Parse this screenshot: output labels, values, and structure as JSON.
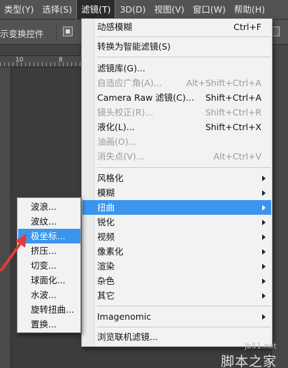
{
  "menubar": {
    "items": [
      "类型(Y)",
      "选择(S)",
      "滤镜(T)",
      "3D(D)",
      "视图(V)",
      "窗口(W)",
      "帮助(H)"
    ]
  },
  "optbar": {
    "transform_label": "示变换控件"
  },
  "ruler": {
    "labels": [
      "10",
      "8"
    ]
  },
  "filter_menu": {
    "items": [
      {
        "label": "动感模糊",
        "shortcut": "Ctrl+F",
        "enabled": true,
        "submenu": false
      },
      {
        "label": "转换为智能滤镜(S)",
        "shortcut": "",
        "enabled": true,
        "submenu": false
      },
      {
        "label": "滤镜库(G)...",
        "shortcut": "",
        "enabled": true,
        "submenu": false
      },
      {
        "label": "自适应广角(A)...",
        "shortcut": "Alt+Shift+Ctrl+A",
        "enabled": false,
        "submenu": false
      },
      {
        "label": "Camera Raw 滤镜(C)...",
        "shortcut": "Shift+Ctrl+A",
        "enabled": true,
        "submenu": false
      },
      {
        "label": "镜头校正(R)...",
        "shortcut": "Shift+Ctrl+R",
        "enabled": false,
        "submenu": false
      },
      {
        "label": "液化(L)...",
        "shortcut": "Shift+Ctrl+X",
        "enabled": true,
        "submenu": false
      },
      {
        "label": "油画(O)...",
        "shortcut": "",
        "enabled": false,
        "submenu": false
      },
      {
        "label": "消失点(V)...",
        "shortcut": "Alt+Ctrl+V",
        "enabled": false,
        "submenu": false
      },
      {
        "label": "风格化",
        "shortcut": "",
        "enabled": true,
        "submenu": true
      },
      {
        "label": "模糊",
        "shortcut": "",
        "enabled": true,
        "submenu": true
      },
      {
        "label": "扭曲",
        "shortcut": "",
        "enabled": true,
        "submenu": true,
        "highlighted": true
      },
      {
        "label": "锐化",
        "shortcut": "",
        "enabled": true,
        "submenu": true
      },
      {
        "label": "视频",
        "shortcut": "",
        "enabled": true,
        "submenu": true
      },
      {
        "label": "像素化",
        "shortcut": "",
        "enabled": true,
        "submenu": true
      },
      {
        "label": "渲染",
        "shortcut": "",
        "enabled": true,
        "submenu": true
      },
      {
        "label": "杂色",
        "shortcut": "",
        "enabled": true,
        "submenu": true
      },
      {
        "label": "其它",
        "shortcut": "",
        "enabled": true,
        "submenu": true
      },
      {
        "label": "Imagenomic",
        "shortcut": "",
        "enabled": true,
        "submenu": true
      },
      {
        "label": "浏览联机滤镜...",
        "shortcut": "",
        "enabled": true,
        "submenu": false
      }
    ]
  },
  "distort_submenu": {
    "items": [
      {
        "label": "波浪..."
      },
      {
        "label": "波纹..."
      },
      {
        "label": "极坐标...",
        "highlighted": true
      },
      {
        "label": "挤压..."
      },
      {
        "label": "切变..."
      },
      {
        "label": "球面化..."
      },
      {
        "label": "水波..."
      },
      {
        "label": "旋转扭曲..."
      },
      {
        "label": "置换..."
      }
    ]
  },
  "watermark": {
    "url": "jb51.net",
    "name": "脚本之家"
  },
  "colors": {
    "highlight": "#3b95ef",
    "annotation": "#e53935"
  }
}
